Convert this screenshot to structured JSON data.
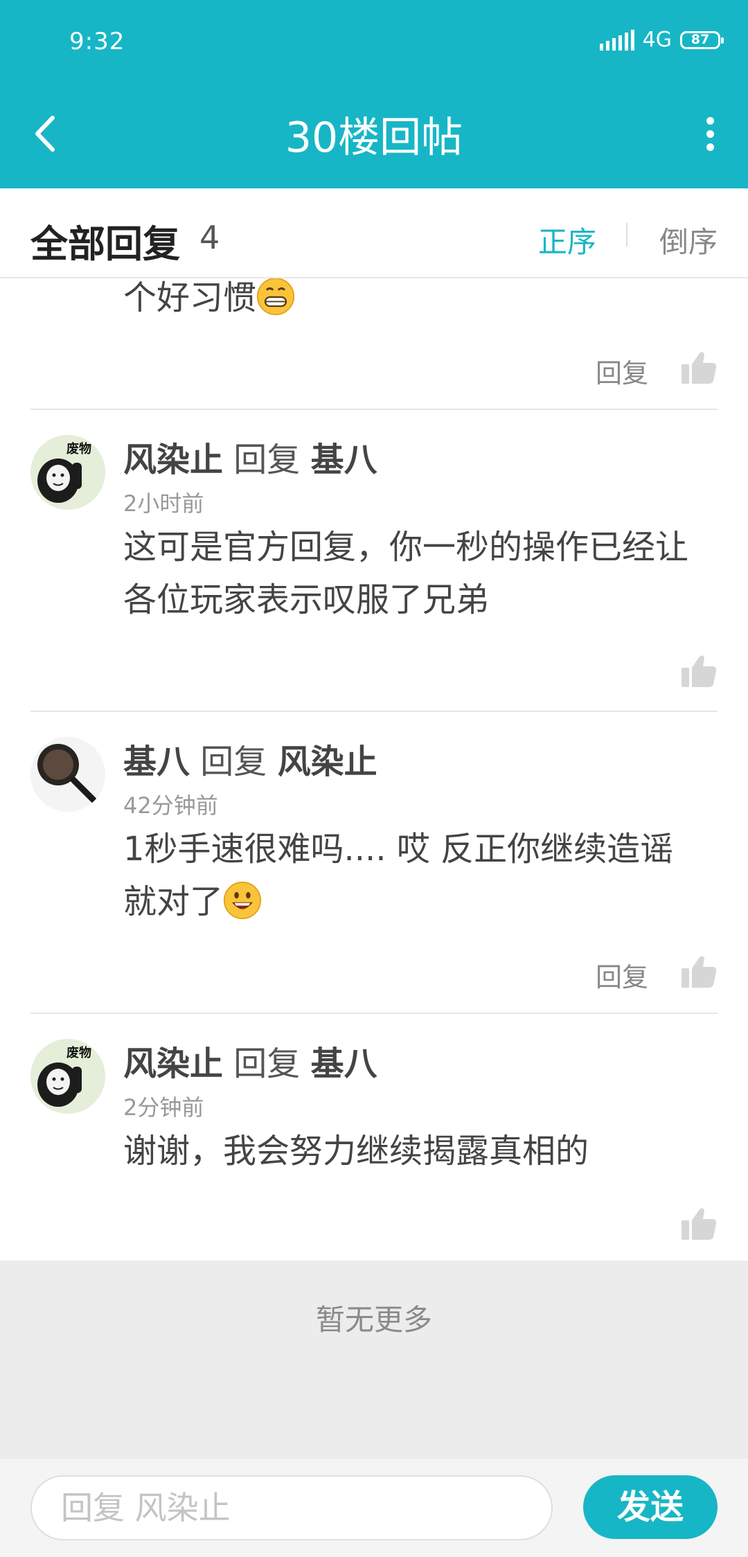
{
  "status_bar": {
    "time": "9:32",
    "network": "4G",
    "battery": "87"
  },
  "nav": {
    "title": "30楼回帖"
  },
  "header": {
    "title": "全部回复",
    "count": "4",
    "sort_asc": "正序",
    "sort_desc": "倒序"
  },
  "partial": {
    "text": "个好习惯",
    "reply_label": "回复"
  },
  "replies": [
    {
      "user": "风染止",
      "word": "回复",
      "target": "基八",
      "time": "2小时前",
      "line1": "这可是官方回复，你一秒的操作已经让",
      "line2": "各位玩家表示叹服了兄弟",
      "avatar_text": "废物"
    },
    {
      "user": "基八",
      "word": "回复",
      "target": "风染止",
      "time": "42分钟前",
      "line1": "1秒手速很难吗.... 哎 反正你继续造谣",
      "line2": "就对了",
      "reply_label": "回复"
    },
    {
      "user": "风染止",
      "word": "回复",
      "target": "基八",
      "time": "2分钟前",
      "line1": "谢谢，我会努力继续揭露真相的",
      "avatar_text": "废物"
    }
  ],
  "footer": {
    "no_more": "暂无更多"
  },
  "composer": {
    "placeholder": "回复 风染止",
    "send_label": "发送"
  },
  "colors": {
    "accent": "#17b6c6"
  }
}
